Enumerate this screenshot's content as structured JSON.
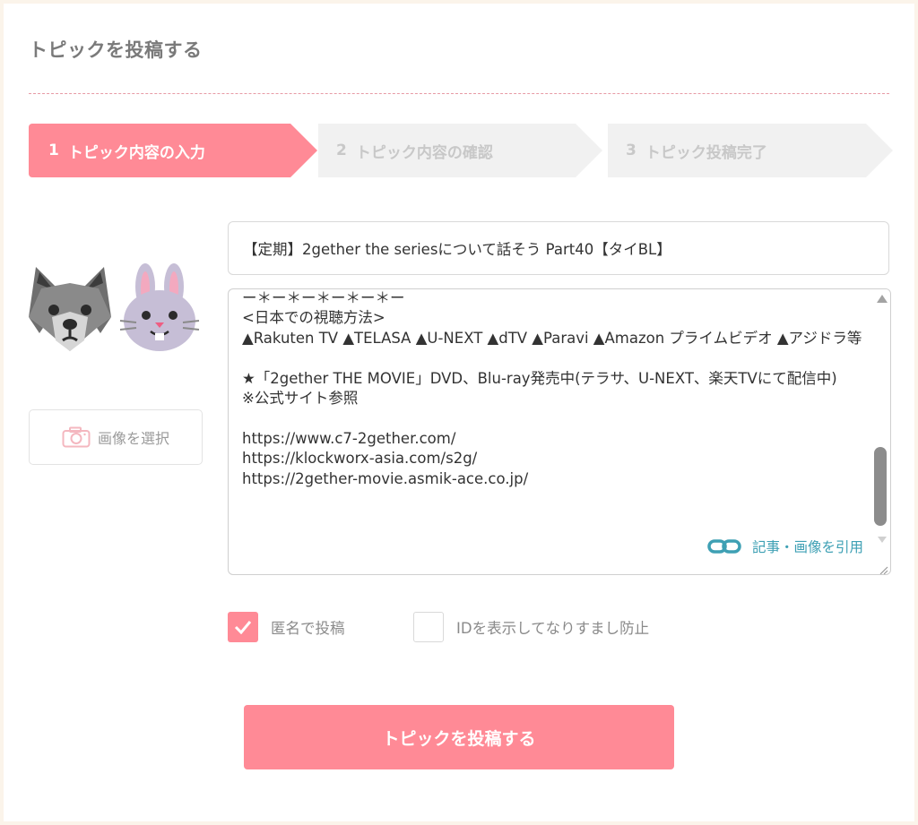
{
  "page": {
    "title": "トピックを投稿する"
  },
  "steps": [
    {
      "num": "1",
      "label": "トピック内容の入力",
      "active": true
    },
    {
      "num": "2",
      "label": "トピック内容の確認",
      "active": false
    },
    {
      "num": "3",
      "label": "トピック投稿完了",
      "active": false
    }
  ],
  "avatars": {
    "left": "wolf-icon",
    "right": "rabbit-icon"
  },
  "image_button": {
    "label": "画像を選択",
    "icon": "camera-icon"
  },
  "topic_title": {
    "value": "【定期】2gether the seriesについて話そう Part40【タイBL】"
  },
  "topic_body": {
    "text": "ー＊ー＊ー＊ー＊ー＊ー\n<日本での視聴方法>\n▲Rakuten TV ▲TELASA ▲U-NEXT ▲dTV ▲Paravi ▲Amazon プライムビデオ ▲アジドラ等\n\n★「2gether THE MOVIE」DVD、Blu-ray発売中(テラサ、U-NEXT、楽天TVにて配信中)\n※公式サイト参照\n\nhttps://www.c7-2gether.com/\nhttps://klockworx-asia.com/s2g/\nhttps://2gether-movie.asmik-ace.co.jp/"
  },
  "cite_link": {
    "label": "記事・画像を引用",
    "icon": "link-icon"
  },
  "options": {
    "anonymous": {
      "label": "匿名で投稿",
      "checked": true
    },
    "show_id": {
      "label": "IDを表示してなりすまし防止",
      "checked": false
    }
  },
  "submit": {
    "label": "トピックを投稿する"
  },
  "colors": {
    "accent": "#ff8a96",
    "link": "#3ea0b4",
    "inactive_step": "#f1f1f1"
  }
}
